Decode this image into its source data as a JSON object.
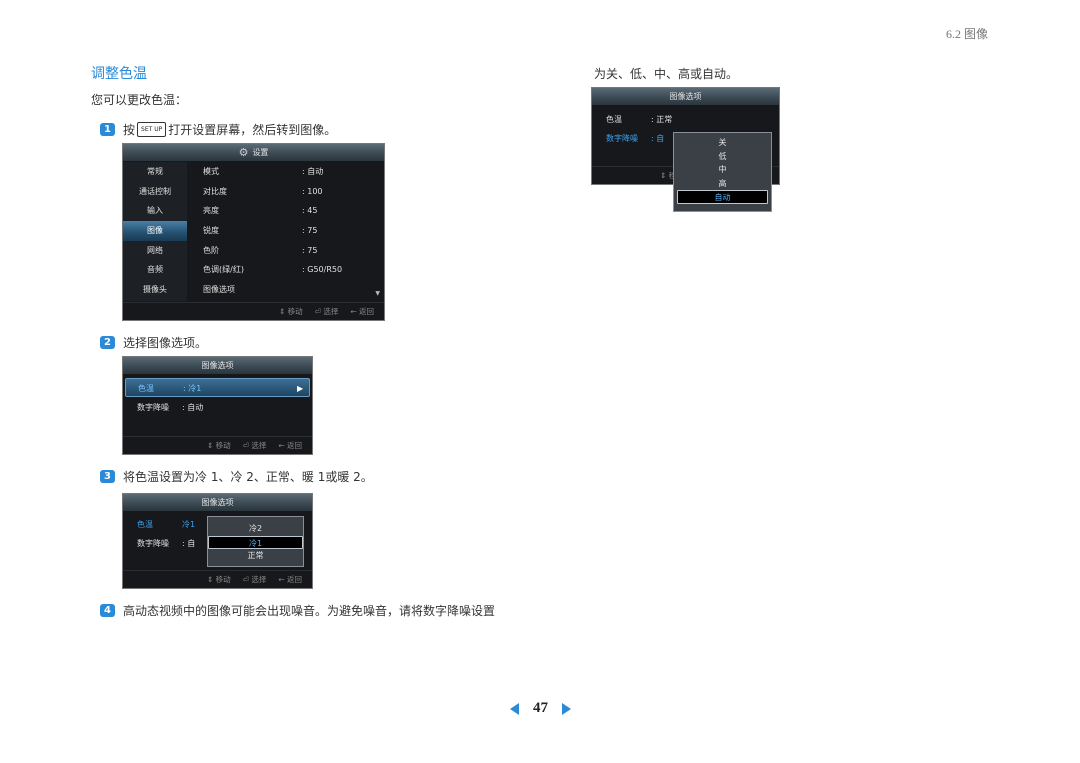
{
  "header": {
    "section_ref": "6.2 图像"
  },
  "title": "调整色温",
  "intro": "您可以更改色温：",
  "steps": [
    {
      "num": "1",
      "before": "按",
      "key": "SET UP",
      "after": "打开设置屏幕，然后转到图像。"
    },
    {
      "num": "2",
      "text": "选择图像选项。"
    },
    {
      "num": "3",
      "text": "将色温设置为冷 1、冷 2、正常、暖 1或暖 2。"
    },
    {
      "num": "4",
      "text": "高动态视频中的图像可能会出现噪音。为避免噪音，请将数字降噪设置"
    }
  ],
  "right_column": {
    "continuation": "为关、低、中、高或自动。"
  },
  "osd_main": {
    "title": "设置",
    "icon": "gear-icon",
    "sidebar": [
      "常规",
      "通话控制",
      "输入",
      "图像",
      "网络",
      "音频",
      "摄像头"
    ],
    "active_sidebar": "图像",
    "rows": [
      {
        "label": "模式",
        "value": ": 自动"
      },
      {
        "label": "对比度",
        "value": ": 100"
      },
      {
        "label": "亮度",
        "value": ": 45"
      },
      {
        "label": "锐度",
        "value": ": 75"
      },
      {
        "label": "色阶",
        "value": ": 75"
      },
      {
        "label": "色调(绿/红)",
        "value": ": G50/R50"
      },
      {
        "label": "图像选项",
        "value": ""
      }
    ],
    "footer": {
      "move": "⇕ 移动",
      "select": "选择",
      "back": "← 返回"
    }
  },
  "osd_options_2": {
    "title": "图像选项",
    "rows": [
      {
        "label": "色温",
        "value": ": 冷1"
      },
      {
        "label": "数字降噪",
        "value": ": 自动"
      }
    ],
    "footer": {
      "move": "⇕ 移动",
      "select": "选择",
      "back": "← 返回"
    }
  },
  "osd_options_3": {
    "title": "图像选项",
    "rows": [
      {
        "label": "色温",
        "value": "冷1"
      },
      {
        "label": "数字降噪",
        "value": ": 自"
      }
    ],
    "popup": [
      "冷2",
      "冷1",
      "正常"
    ],
    "popup_selected": "冷1",
    "footer": {
      "move": "⇕ 移动",
      "select": "选择",
      "back": "← 返回"
    }
  },
  "osd_options_4": {
    "title": "图像选项",
    "rows": [
      {
        "label": "色温",
        "value": ": 正常"
      },
      {
        "label": "数字降噪",
        "value": ": 自"
      }
    ],
    "popup": [
      "关",
      "低",
      "中",
      "高",
      "自动"
    ],
    "popup_selected": "自动",
    "footer": {
      "move": "⇕ 移"
    }
  },
  "pagination": {
    "page": "47"
  },
  "colors": {
    "accent": "#2a8ad8",
    "osd_bg": "#16181b",
    "osd_highlight": "#3ea3f0"
  }
}
